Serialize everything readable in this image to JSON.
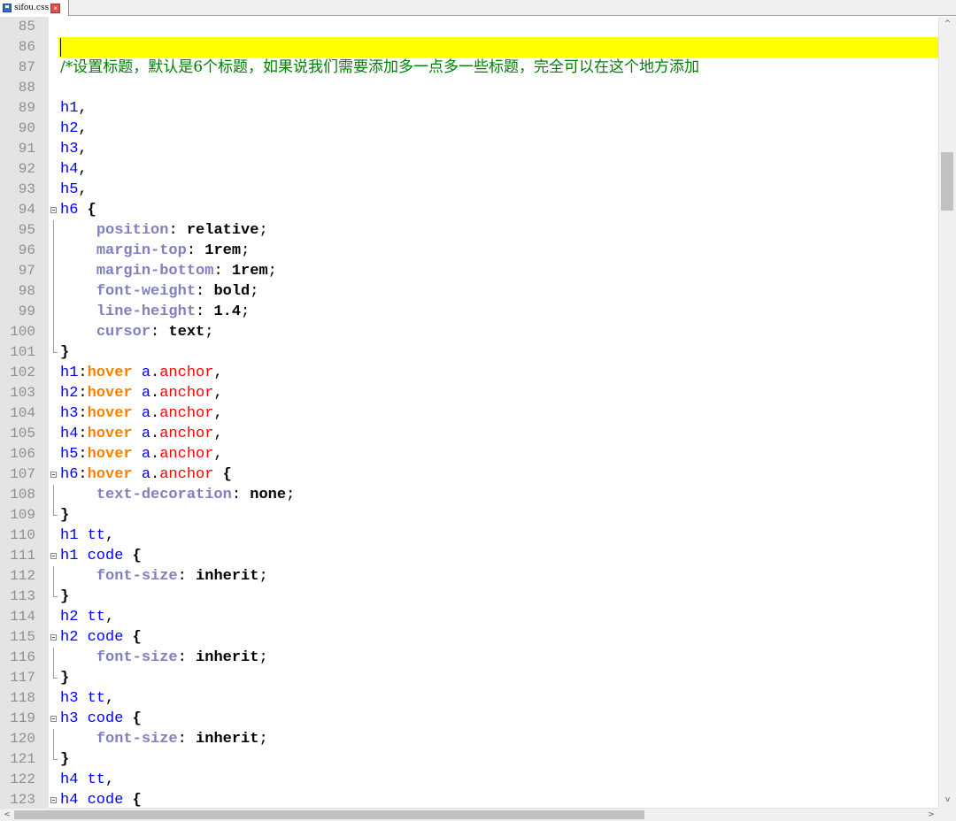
{
  "tab": {
    "filename": "sifou.css",
    "save_icon": "save-icon",
    "close_icon": "close-icon"
  },
  "editor": {
    "current_line": 86,
    "lines": [
      {
        "n": "85",
        "tokens": []
      },
      {
        "n": "86",
        "tokens": []
      },
      {
        "n": "87",
        "tokens": [
          [
            "cm",
            "/*设置标题，默认是6个标题，如果说我们需要添加多一点多一些标题，完全可以在这个地方添加"
          ]
        ]
      },
      {
        "n": "88",
        "tokens": []
      },
      {
        "n": "89",
        "tokens": [
          [
            "sel",
            "h1"
          ],
          [
            "",
            ","
          ]
        ]
      },
      {
        "n": "90",
        "tokens": [
          [
            "sel",
            "h2"
          ],
          [
            "",
            ","
          ]
        ]
      },
      {
        "n": "91",
        "tokens": [
          [
            "sel",
            "h3"
          ],
          [
            "",
            ","
          ]
        ]
      },
      {
        "n": "92",
        "tokens": [
          [
            "sel",
            "h4"
          ],
          [
            "",
            ","
          ]
        ]
      },
      {
        "n": "93",
        "tokens": [
          [
            "sel",
            "h5"
          ],
          [
            "",
            ","
          ]
        ]
      },
      {
        "n": "94",
        "tokens": [
          [
            "sel",
            "h6"
          ],
          [
            "",
            " "
          ],
          [
            "br",
            "{"
          ]
        ],
        "fold": "start"
      },
      {
        "n": "95",
        "tokens": [
          [
            "",
            "    "
          ],
          [
            "pr",
            "position"
          ],
          [
            "",
            ": "
          ],
          [
            "val",
            "relative"
          ],
          [
            "",
            ";"
          ]
        ],
        "fold": "mid"
      },
      {
        "n": "96",
        "tokens": [
          [
            "",
            "    "
          ],
          [
            "pr",
            "margin-top"
          ],
          [
            "",
            ": "
          ],
          [
            "val",
            "1rem"
          ],
          [
            "",
            ";"
          ]
        ],
        "fold": "mid"
      },
      {
        "n": "97",
        "tokens": [
          [
            "",
            "    "
          ],
          [
            "pr",
            "margin-bottom"
          ],
          [
            "",
            ": "
          ],
          [
            "val",
            "1rem"
          ],
          [
            "",
            ";"
          ]
        ],
        "fold": "mid"
      },
      {
        "n": "98",
        "tokens": [
          [
            "",
            "    "
          ],
          [
            "pr",
            "font-weight"
          ],
          [
            "",
            ": "
          ],
          [
            "val",
            "bold"
          ],
          [
            "",
            ";"
          ]
        ],
        "fold": "mid"
      },
      {
        "n": "99",
        "tokens": [
          [
            "",
            "    "
          ],
          [
            "pr",
            "line-height"
          ],
          [
            "",
            ": "
          ],
          [
            "val",
            "1.4"
          ],
          [
            "",
            ";"
          ]
        ],
        "fold": "mid"
      },
      {
        "n": "100",
        "tokens": [
          [
            "",
            "    "
          ],
          [
            "pr",
            "cursor"
          ],
          [
            "",
            ": "
          ],
          [
            "val",
            "text"
          ],
          [
            "",
            ";"
          ]
        ],
        "fold": "mid"
      },
      {
        "n": "101",
        "tokens": [
          [
            "br",
            "}"
          ]
        ],
        "fold": "end"
      },
      {
        "n": "102",
        "tokens": [
          [
            "sel",
            "h1"
          ],
          [
            "",
            ":"
          ],
          [
            "ps",
            "hover"
          ],
          [
            "",
            " "
          ],
          [
            "sel",
            "a"
          ],
          [
            "",
            "."
          ],
          [
            "cls",
            "anchor"
          ],
          [
            "",
            ","
          ]
        ]
      },
      {
        "n": "103",
        "tokens": [
          [
            "sel",
            "h2"
          ],
          [
            "",
            ":"
          ],
          [
            "ps",
            "hover"
          ],
          [
            "",
            " "
          ],
          [
            "sel",
            "a"
          ],
          [
            "",
            "."
          ],
          [
            "cls",
            "anchor"
          ],
          [
            "",
            ","
          ]
        ]
      },
      {
        "n": "104",
        "tokens": [
          [
            "sel",
            "h3"
          ],
          [
            "",
            ":"
          ],
          [
            "ps",
            "hover"
          ],
          [
            "",
            " "
          ],
          [
            "sel",
            "a"
          ],
          [
            "",
            "."
          ],
          [
            "cls",
            "anchor"
          ],
          [
            "",
            ","
          ]
        ]
      },
      {
        "n": "105",
        "tokens": [
          [
            "sel",
            "h4"
          ],
          [
            "",
            ":"
          ],
          [
            "ps",
            "hover"
          ],
          [
            "",
            " "
          ],
          [
            "sel",
            "a"
          ],
          [
            "",
            "."
          ],
          [
            "cls",
            "anchor"
          ],
          [
            "",
            ","
          ]
        ]
      },
      {
        "n": "106",
        "tokens": [
          [
            "sel",
            "h5"
          ],
          [
            "",
            ":"
          ],
          [
            "ps",
            "hover"
          ],
          [
            "",
            " "
          ],
          [
            "sel",
            "a"
          ],
          [
            "",
            "."
          ],
          [
            "cls",
            "anchor"
          ],
          [
            "",
            ","
          ]
        ]
      },
      {
        "n": "107",
        "tokens": [
          [
            "sel",
            "h6"
          ],
          [
            "",
            ":"
          ],
          [
            "ps",
            "hover"
          ],
          [
            "",
            " "
          ],
          [
            "sel",
            "a"
          ],
          [
            "",
            "."
          ],
          [
            "cls",
            "anchor"
          ],
          [
            "",
            " "
          ],
          [
            "br",
            "{"
          ]
        ],
        "fold": "start"
      },
      {
        "n": "108",
        "tokens": [
          [
            "",
            "    "
          ],
          [
            "pr",
            "text-decoration"
          ],
          [
            "",
            ": "
          ],
          [
            "val",
            "none"
          ],
          [
            "",
            ";"
          ]
        ],
        "fold": "mid"
      },
      {
        "n": "109",
        "tokens": [
          [
            "br",
            "}"
          ]
        ],
        "fold": "end"
      },
      {
        "n": "110",
        "tokens": [
          [
            "sel",
            "h1"
          ],
          [
            "",
            " "
          ],
          [
            "sel",
            "tt"
          ],
          [
            "",
            ","
          ]
        ]
      },
      {
        "n": "111",
        "tokens": [
          [
            "sel",
            "h1"
          ],
          [
            "",
            " "
          ],
          [
            "sel",
            "code"
          ],
          [
            "",
            " "
          ],
          [
            "br",
            "{"
          ]
        ],
        "fold": "start"
      },
      {
        "n": "112",
        "tokens": [
          [
            "",
            "    "
          ],
          [
            "pr",
            "font-size"
          ],
          [
            "",
            ": "
          ],
          [
            "val",
            "inherit"
          ],
          [
            "",
            ";"
          ]
        ],
        "fold": "mid"
      },
      {
        "n": "113",
        "tokens": [
          [
            "br",
            "}"
          ]
        ],
        "fold": "end"
      },
      {
        "n": "114",
        "tokens": [
          [
            "sel",
            "h2"
          ],
          [
            "",
            " "
          ],
          [
            "sel",
            "tt"
          ],
          [
            "",
            ","
          ]
        ]
      },
      {
        "n": "115",
        "tokens": [
          [
            "sel",
            "h2"
          ],
          [
            "",
            " "
          ],
          [
            "sel",
            "code"
          ],
          [
            "",
            " "
          ],
          [
            "br",
            "{"
          ]
        ],
        "fold": "start"
      },
      {
        "n": "116",
        "tokens": [
          [
            "",
            "    "
          ],
          [
            "pr",
            "font-size"
          ],
          [
            "",
            ": "
          ],
          [
            "val",
            "inherit"
          ],
          [
            "",
            ";"
          ]
        ],
        "fold": "mid"
      },
      {
        "n": "117",
        "tokens": [
          [
            "br",
            "}"
          ]
        ],
        "fold": "end"
      },
      {
        "n": "118",
        "tokens": [
          [
            "sel",
            "h3"
          ],
          [
            "",
            " "
          ],
          [
            "sel",
            "tt"
          ],
          [
            "",
            ","
          ]
        ]
      },
      {
        "n": "119",
        "tokens": [
          [
            "sel",
            "h3"
          ],
          [
            "",
            " "
          ],
          [
            "sel",
            "code"
          ],
          [
            "",
            " "
          ],
          [
            "br",
            "{"
          ]
        ],
        "fold": "start"
      },
      {
        "n": "120",
        "tokens": [
          [
            "",
            "    "
          ],
          [
            "pr",
            "font-size"
          ],
          [
            "",
            ": "
          ],
          [
            "val",
            "inherit"
          ],
          [
            "",
            ";"
          ]
        ],
        "fold": "mid"
      },
      {
        "n": "121",
        "tokens": [
          [
            "br",
            "}"
          ]
        ],
        "fold": "end"
      },
      {
        "n": "122",
        "tokens": [
          [
            "sel",
            "h4"
          ],
          [
            "",
            " "
          ],
          [
            "sel",
            "tt"
          ],
          [
            "",
            ","
          ]
        ]
      },
      {
        "n": "123",
        "tokens": [
          [
            "sel",
            "h4"
          ],
          [
            "",
            " "
          ],
          [
            "sel",
            "code"
          ],
          [
            "",
            " "
          ],
          [
            "br",
            "{"
          ]
        ],
        "fold": "start"
      }
    ]
  },
  "colors": {
    "current_line_highlight": "#ffff00",
    "gutter": "#e4e4e4",
    "comment": "#008000",
    "selector": "#0000ff",
    "property": "#8080c0",
    "pseudo": "#ff8000",
    "class": "#ff0000"
  },
  "scrollbars": {
    "up_icon": "scroll-up-icon",
    "down_icon": "scroll-down-icon",
    "left_icon": "scroll-left-icon",
    "right_icon": "scroll-right-icon",
    "up_glyph": "^",
    "down_glyph": "v",
    "left_glyph": "<",
    "right_glyph": ">"
  }
}
